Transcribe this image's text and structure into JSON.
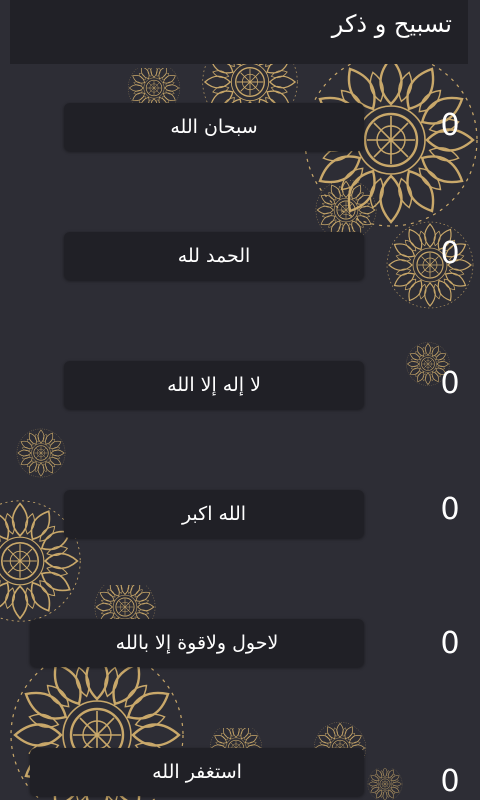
{
  "header": {
    "title": "تسبيح و ذكر"
  },
  "dhikr_items": [
    {
      "label": "سبحان الله",
      "count": "0"
    },
    {
      "label": "الحمد لله",
      "count": "0"
    },
    {
      "label": "لا إله إلا الله",
      "count": "0"
    },
    {
      "label": "الله اكبر",
      "count": "0"
    },
    {
      "label": "لاحول ولاقوة إلا بالله",
      "count": "0"
    },
    {
      "label": "استغفر الله",
      "count": "0"
    }
  ],
  "colors": {
    "background": "#2d2d35",
    "bar": "#212127",
    "ornament_gold": "#c9a86a",
    "text": "#ffffff"
  },
  "icons": {
    "ornament": "mandala-ornament-icon"
  }
}
